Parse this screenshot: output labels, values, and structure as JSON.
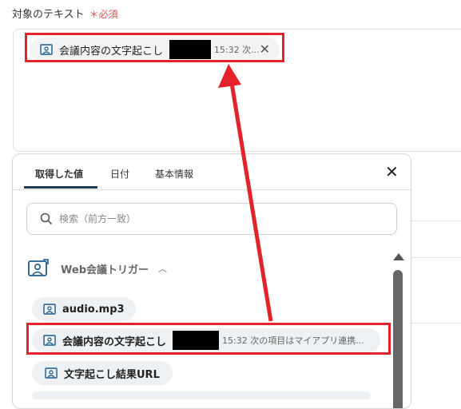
{
  "field": {
    "label": "対象のテキスト",
    "required": "＊必須"
  },
  "selected_chip": {
    "title": "会議内容の文字起こし",
    "sub": "15:32 次...",
    "close": "✕"
  },
  "panel": {
    "tabs": [
      {
        "label": "取得した値"
      },
      {
        "label": "日付"
      },
      {
        "label": "基本情報"
      }
    ],
    "close": "✕",
    "search_placeholder": "検索（前方一致）",
    "section_label": "Web会議トリガー",
    "section_chevron": "︿",
    "items": [
      {
        "title": "audio.mp3",
        "sub": ""
      },
      {
        "title": "会議内容の文字起こし",
        "sub": "15:32 次の項目はマイアプリ連携..."
      },
      {
        "title": "文字起こし結果URL",
        "sub": ""
      }
    ]
  },
  "colors": {
    "highlight": "#e3222a",
    "tab_underline": "#1c3c5c",
    "chip_bg": "#eef1f3",
    "required": "#e05252"
  },
  "icons": [
    "media-icon",
    "close-icon",
    "search-icon",
    "chevron-up-icon",
    "scroll-up-icon"
  ]
}
